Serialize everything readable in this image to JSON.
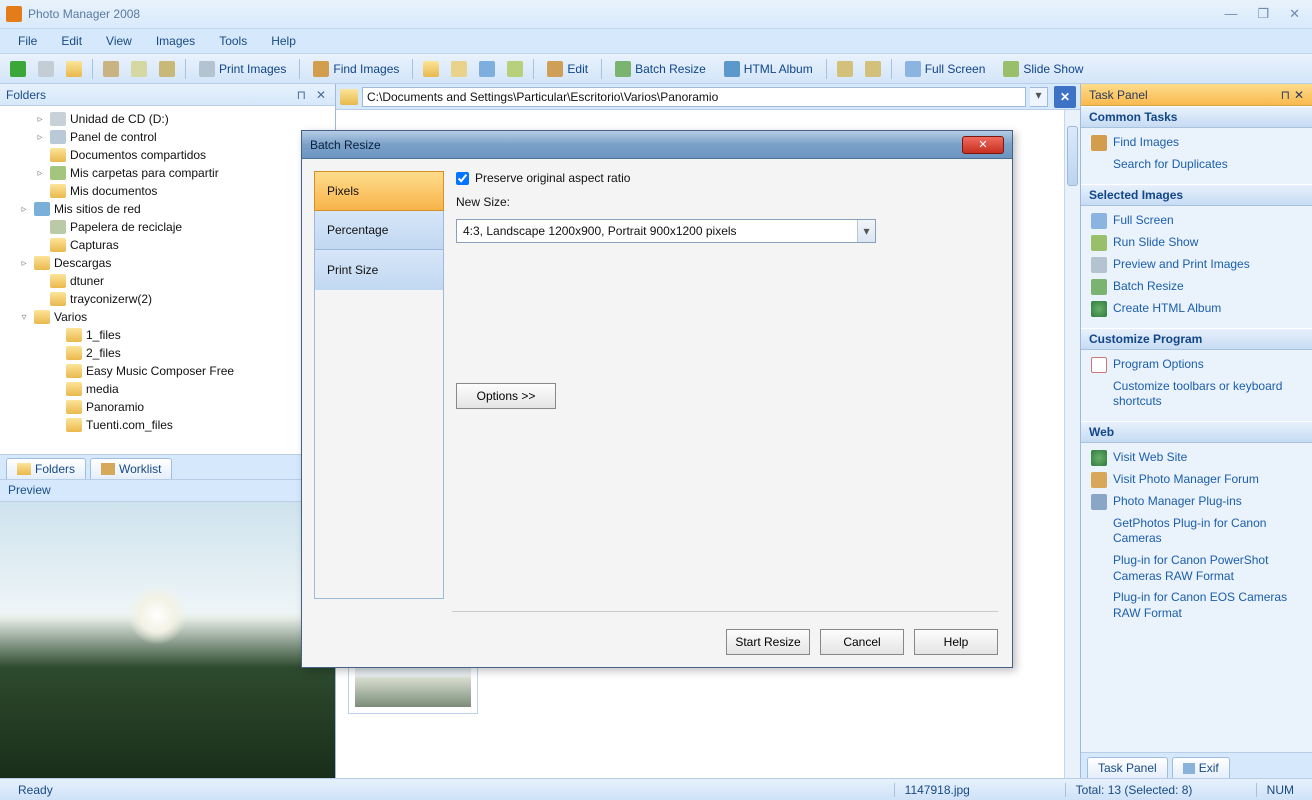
{
  "app": {
    "title": "Photo Manager 2008"
  },
  "menu": {
    "file": "File",
    "edit": "Edit",
    "view": "View",
    "images": "Images",
    "tools": "Tools",
    "help": "Help"
  },
  "toolbar": {
    "print": "Print Images",
    "find": "Find Images",
    "edit": "Edit",
    "batch": "Batch Resize",
    "html": "HTML Album",
    "fullscreen": "Full Screen",
    "slide": "Slide Show"
  },
  "folders": {
    "title": "Folders",
    "nodes": [
      {
        "indent": 2,
        "tw": "▹",
        "icon": "c-disk",
        "label": "Unidad de CD (D:)"
      },
      {
        "indent": 2,
        "tw": "▹",
        "icon": "c-panel",
        "label": "Panel de control"
      },
      {
        "indent": 2,
        "tw": "",
        "icon": "c-fold",
        "label": "Documentos compartidos"
      },
      {
        "indent": 2,
        "tw": "▹",
        "icon": "c-share",
        "label": "Mis carpetas para compartir"
      },
      {
        "indent": 2,
        "tw": "",
        "icon": "c-fold",
        "label": "Mis documentos"
      },
      {
        "indent": 1,
        "tw": "▹",
        "icon": "c-net",
        "label": "Mis sitios de red"
      },
      {
        "indent": 2,
        "tw": "",
        "icon": "c-trash",
        "label": "Papelera de reciclaje"
      },
      {
        "indent": 2,
        "tw": "",
        "icon": "c-fold",
        "label": "Capturas"
      },
      {
        "indent": 1,
        "tw": "▹",
        "icon": "c-fold",
        "label": "Descargas"
      },
      {
        "indent": 2,
        "tw": "",
        "icon": "c-fold",
        "label": "dtuner"
      },
      {
        "indent": 2,
        "tw": "",
        "icon": "c-fold",
        "label": "trayconizerw(2)"
      },
      {
        "indent": 1,
        "tw": "▿",
        "icon": "c-fold",
        "label": "Varios"
      },
      {
        "indent": 3,
        "tw": "",
        "icon": "c-fold",
        "label": "1_files"
      },
      {
        "indent": 3,
        "tw": "",
        "icon": "c-fold",
        "label": "2_files"
      },
      {
        "indent": 3,
        "tw": "",
        "icon": "c-fold",
        "label": "Easy Music Composer Free"
      },
      {
        "indent": 3,
        "tw": "",
        "icon": "c-fold",
        "label": "media"
      },
      {
        "indent": 3,
        "tw": "",
        "icon": "c-fold",
        "label": "Panoramio"
      },
      {
        "indent": 3,
        "tw": "",
        "icon": "c-fold",
        "label": "Tuenti.com_files"
      }
    ],
    "tab_folders": "Folders",
    "tab_worklist": "Worklist",
    "preview": "Preview"
  },
  "path": {
    "value": "C:\\Documents and Settings\\Particular\\Escritorio\\Varios\\Panoramio"
  },
  "taskpanel": {
    "title": "Task Panel",
    "sections": {
      "common": {
        "title": "Common Tasks",
        "items": [
          "Find Images",
          "Search for Duplicates"
        ]
      },
      "selected": {
        "title": "Selected Images",
        "items": [
          "Full Screen",
          "Run Slide Show",
          "Preview and Print Images",
          "Batch Resize",
          "Create HTML Album"
        ]
      },
      "customize": {
        "title": "Customize Program",
        "items": [
          "Program Options",
          "Customize toolbars or keyboard shortcuts"
        ]
      },
      "web": {
        "title": "Web",
        "items": [
          "Visit Web Site",
          "Visit Photo Manager Forum",
          "Photo Manager Plug-ins",
          "GetPhotos Plug-in for Canon Cameras",
          "Plug-in for Canon PowerShot Cameras RAW Format",
          "Plug-in for Canon EOS Cameras RAW Format"
        ]
      }
    },
    "tab_task": "Task Panel",
    "tab_exif": "Exif"
  },
  "status": {
    "ready": "Ready",
    "file": "1147918.jpg",
    "total": "Total: 13 (Selected: 8)",
    "num": "NUM"
  },
  "dialog": {
    "title": "Batch Resize",
    "tabs": {
      "pixels": "Pixels",
      "percentage": "Percentage",
      "printsize": "Print Size"
    },
    "preserve": "Preserve original aspect ratio",
    "newsize": "New Size:",
    "size_value": "4:3, Landscape 1200x900, Portrait 900x1200 pixels",
    "options": "Options >>",
    "start": "Start Resize",
    "cancel": "Cancel",
    "help": "Help"
  }
}
